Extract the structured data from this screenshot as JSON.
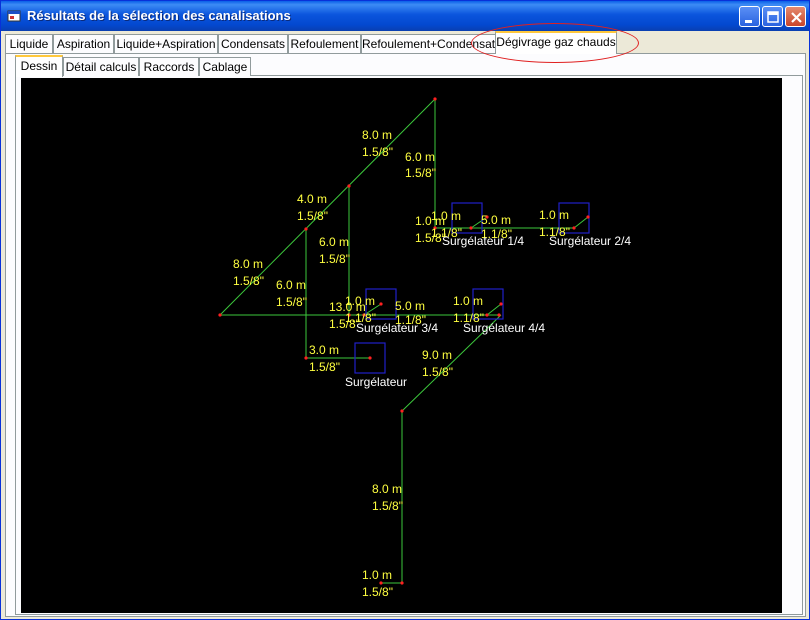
{
  "window": {
    "title": "Résultats de la sélection des canalisations"
  },
  "tabs": [
    {
      "label": "Liquide"
    },
    {
      "label": "Aspiration"
    },
    {
      "label": "Liquide+Aspiration"
    },
    {
      "label": "Condensats"
    },
    {
      "label": "Refoulement"
    },
    {
      "label": "Refoulement+Condensats"
    },
    {
      "label": "Dégivrage gaz chauds"
    }
  ],
  "active_tab": "Dégivrage gaz chauds",
  "subtabs": [
    {
      "label": "Dessin"
    },
    {
      "label": "Détail calculs"
    },
    {
      "label": "Raccords"
    },
    {
      "label": "Cablage"
    }
  ],
  "active_subtab": "Dessin",
  "colors": {
    "pipe": "#3cc83c",
    "node": "#ff2020",
    "unit_box": "#2020c8",
    "length_text": "#ffff40",
    "unit_text": "#ffffff",
    "highlight": "#e02020"
  },
  "drawing": {
    "segments": [
      {
        "length": "8.0 m",
        "diameter": "1.5/8\""
      },
      {
        "length": "6.0 m",
        "diameter": "1.5/8\""
      },
      {
        "length": "4.0 m",
        "diameter": "1.5/8\""
      },
      {
        "length": "6.0 m",
        "diameter": "1.5/8\""
      },
      {
        "length": "8.0 m",
        "diameter": "1.5/8\""
      },
      {
        "length": "6.0 m",
        "diameter": "1.5/8\""
      },
      {
        "length": "1.0 m",
        "diameter": "1.5/8\""
      },
      {
        "length": "1.0 m",
        "diameter": "1.1/8\""
      },
      {
        "length": "5.0 m",
        "diameter": "1.1/8\""
      },
      {
        "length": "1.0 m",
        "diameter": "1.1/8\""
      },
      {
        "length": "13.0 m",
        "diameter": "1.5/8\""
      },
      {
        "length": "1.0 m",
        "diameter": "1.1/8\""
      },
      {
        "length": "5.0 m",
        "diameter": "1.1/8\""
      },
      {
        "length": "1.0 m",
        "diameter": "1.1/8\""
      },
      {
        "length": "3.0 m",
        "diameter": "1.5/8\""
      },
      {
        "length": "9.0 m",
        "diameter": "1.5/8\""
      },
      {
        "length": "8.0 m",
        "diameter": "1.5/8\""
      },
      {
        "length": "1.0 m",
        "diameter": "1.5/8\""
      }
    ],
    "units": [
      {
        "label": "Surgélateur 1/4"
      },
      {
        "label": "Surgélateur 2/4"
      },
      {
        "label": "Surgélateur 3/4"
      },
      {
        "label": "Surgélateur 4/4"
      },
      {
        "label": "Surgélateur"
      }
    ]
  }
}
